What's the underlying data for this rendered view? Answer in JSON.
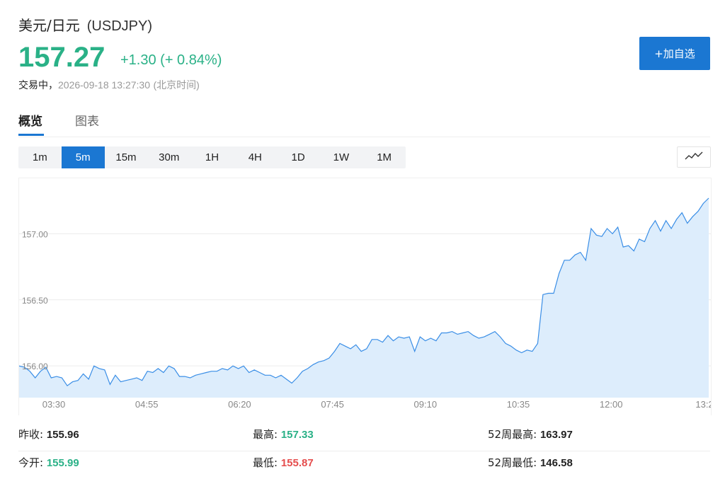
{
  "header": {
    "pair_name": "美元/日元",
    "pair_code": "(USDJPY)",
    "price": "157.27",
    "change": "+1.30 (+ 0.84%)",
    "status": "交易中，",
    "datetime": "2026-09-18 13:27:30",
    "timezone": "(北京时间)",
    "add_button": "+加自选"
  },
  "tabs": [
    "概览",
    "图表"
  ],
  "periods": {
    "items": [
      "1m",
      "5m",
      "15m",
      "30m",
      "1H",
      "4H",
      "1D",
      "1W",
      "1M"
    ],
    "selected": "5m"
  },
  "icons": {
    "chart_type": "line-chart-icon"
  },
  "colors": {
    "up": "#2ab187",
    "down": "#e54d4d",
    "accent": "#1b77d2",
    "line": "#3a8ee6",
    "fill": "#ddedfc"
  },
  "chart_data": {
    "type": "area",
    "y_ticks": [
      "157.00",
      "156.50",
      "156.00"
    ],
    "x_ticks": [
      "03:30",
      "04:55",
      "06:20",
      "07:45",
      "09:10",
      "10:35",
      "12:00",
      "13:2"
    ],
    "ylim": [
      155.76,
      157.42
    ],
    "grid": true,
    "values": [
      156.0,
      155.99,
      155.96,
      155.91,
      155.96,
      155.99,
      155.91,
      155.92,
      155.91,
      155.85,
      155.88,
      155.89,
      155.94,
      155.9,
      156.0,
      155.98,
      155.97,
      155.86,
      155.93,
      155.88,
      155.89,
      155.9,
      155.91,
      155.89,
      155.96,
      155.95,
      155.98,
      155.95,
      156.0,
      155.98,
      155.92,
      155.92,
      155.91,
      155.93,
      155.94,
      155.95,
      155.96,
      155.96,
      155.98,
      155.97,
      156.0,
      155.98,
      156.0,
      155.95,
      155.97,
      155.95,
      155.93,
      155.93,
      155.91,
      155.93,
      155.9,
      155.87,
      155.91,
      155.96,
      155.98,
      156.01,
      156.03,
      156.04,
      156.06,
      156.11,
      156.17,
      156.15,
      156.13,
      156.16,
      156.11,
      156.13,
      156.2,
      156.2,
      156.18,
      156.23,
      156.19,
      156.22,
      156.21,
      156.22,
      156.11,
      156.22,
      156.19,
      156.21,
      156.19,
      156.25,
      156.25,
      156.26,
      156.24,
      156.25,
      156.26,
      156.23,
      156.21,
      156.22,
      156.24,
      156.26,
      156.22,
      156.17,
      156.15,
      156.12,
      156.1,
      156.12,
      156.11,
      156.17,
      156.54,
      156.55,
      156.55,
      156.7,
      156.8,
      156.8,
      156.84,
      156.86,
      156.8,
      157.04,
      156.99,
      156.98,
      157.04,
      157.0,
      157.05,
      156.9,
      156.91,
      156.87,
      156.96,
      156.94,
      157.04,
      157.1,
      157.02,
      157.1,
      157.04,
      157.11,
      157.16,
      157.08,
      157.13,
      157.17,
      157.23,
      157.27
    ]
  },
  "stats": {
    "row1": [
      {
        "label": "昨收:",
        "value": "155.96",
        "tone": "black"
      },
      {
        "label": "最高:",
        "value": "157.33",
        "tone": "green"
      },
      {
        "label": "52周最高:",
        "value": "163.97",
        "tone": "black"
      }
    ],
    "row2": [
      {
        "label": "今开:",
        "value": "155.99",
        "tone": "green"
      },
      {
        "label": "最低:",
        "value": "155.87",
        "tone": "red"
      },
      {
        "label": "52周最低:",
        "value": "146.58",
        "tone": "black"
      }
    ]
  }
}
